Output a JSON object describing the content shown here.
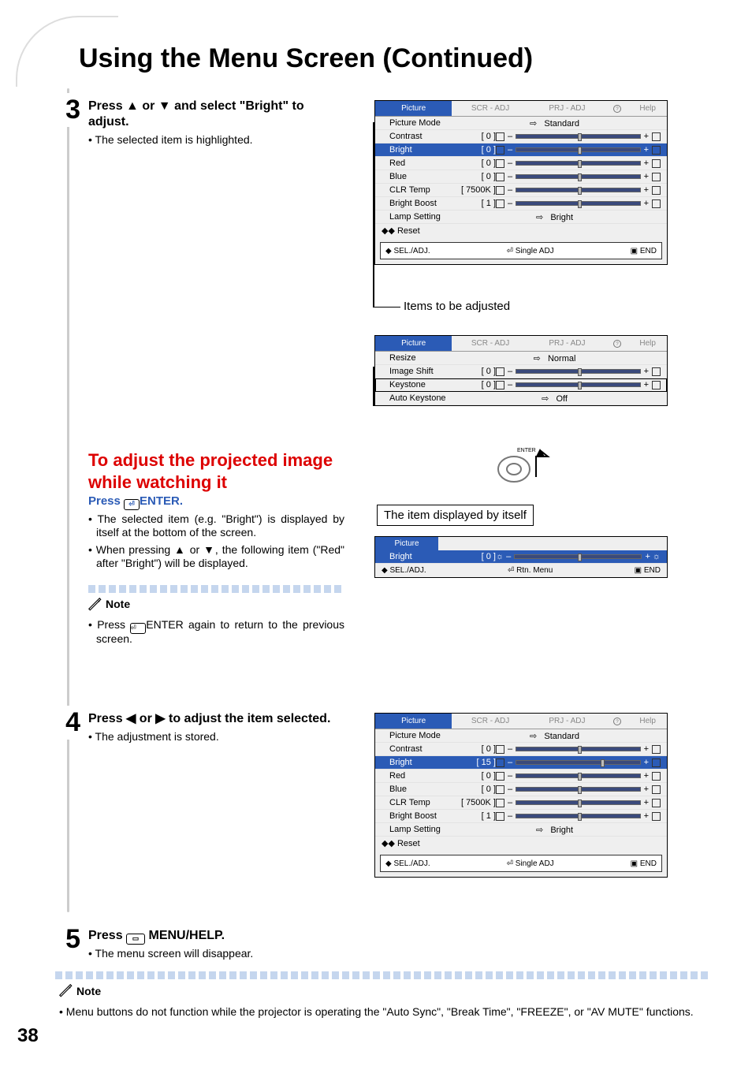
{
  "page_title": "Using the Menu Screen (Continued)",
  "page_number": "38",
  "step3": {
    "num": "3",
    "heading_pre": "Press ",
    "heading_mid": " or ",
    "heading_post": " and select \"Bright\" to adjust.",
    "bullet": "• The selected item is highlighted."
  },
  "adjust_section": {
    "red1": "To adjust the projected image while watching it",
    "press": "Press ",
    "enter_label": "ENTER.",
    "b1": "• The selected item (e.g. \"Bright\") is displayed by itself at the bottom of the screen.",
    "b2_pre": "• When pressing ",
    "b2_mid": " or ",
    "b2_post": ", the following item (\"Red\" after \"Bright\") will be displayed.",
    "note_label": "Note",
    "note_body_pre": "• Press ",
    "note_body_post": "ENTER again to return to the previous screen."
  },
  "step4": {
    "num": "4",
    "heading_pre": "Press ",
    "heading_mid": " or ",
    "heading_post": " to adjust the item selected.",
    "bullet": "• The adjustment is stored."
  },
  "step5": {
    "num": "5",
    "heading_pre": "Press ",
    "heading_post": " MENU/HELP.",
    "bullet": "• The menu screen will disappear."
  },
  "footnote": {
    "label": "Note",
    "text": "• Menu buttons do not function while the projector is operating the \"Auto Sync\", \"Break Time\", \"FREEZE\", or \"AV MUTE\" functions."
  },
  "captions": {
    "items_adjusted": "Items to be adjusted",
    "item_by_itself": "The item displayed by itself",
    "enter_label": "ENTER"
  },
  "osd_tabs": [
    "Picture",
    "SCR - ADJ",
    "PRJ - ADJ",
    "?",
    "Help"
  ],
  "osd1": {
    "rows": [
      {
        "label": "Picture Mode",
        "type": "arrow",
        "value": "Standard"
      },
      {
        "label": "Contrast",
        "type": "bar",
        "val": "0",
        "pos": 50
      },
      {
        "label": "Bright",
        "type": "bar",
        "val": "0",
        "pos": 50,
        "sel": true
      },
      {
        "label": "Red",
        "type": "bar",
        "val": "0",
        "pos": 50
      },
      {
        "label": "Blue",
        "type": "bar",
        "val": "0",
        "pos": 50
      },
      {
        "label": "CLR Temp",
        "type": "bar",
        "val": "7500K",
        "pos": 50
      },
      {
        "label": "Bright Boost",
        "type": "bar",
        "val": "1",
        "pos": 50
      },
      {
        "label": "Lamp Setting",
        "type": "arrow",
        "value": "Bright"
      },
      {
        "label": "Reset",
        "type": "reset"
      }
    ],
    "foot": {
      "l": "SEL./ADJ.",
      "m": "Single ADJ",
      "r": "END"
    }
  },
  "osd2": {
    "rows": [
      {
        "label": "Resize",
        "type": "arrow",
        "value": "Normal"
      },
      {
        "label": "Image Shift",
        "type": "bar",
        "val": "0",
        "pos": 50
      },
      {
        "label": "Keystone",
        "type": "bar",
        "val": "0",
        "pos": 50,
        "outline": true
      },
      {
        "label": "Auto Keystone",
        "type": "arrow",
        "value": "Off"
      }
    ]
  },
  "osd3": {
    "tab": "Picture",
    "row": {
      "label": "Bright",
      "val": "0",
      "pos": 50
    },
    "foot": {
      "l": "SEL./ADJ.",
      "m": "Rtn. Menu",
      "r": "END"
    }
  },
  "osd4": {
    "rows": [
      {
        "label": "Picture Mode",
        "type": "arrow",
        "value": "Standard"
      },
      {
        "label": "Contrast",
        "type": "bar",
        "val": "0",
        "pos": 50
      },
      {
        "label": "Bright",
        "type": "bar",
        "val": "15",
        "pos": 68,
        "sel": true
      },
      {
        "label": "Red",
        "type": "bar",
        "val": "0",
        "pos": 50
      },
      {
        "label": "Blue",
        "type": "bar",
        "val": "0",
        "pos": 50
      },
      {
        "label": "CLR Temp",
        "type": "bar",
        "val": "7500K",
        "pos": 50
      },
      {
        "label": "Bright Boost",
        "type": "bar",
        "val": "1",
        "pos": 50
      },
      {
        "label": "Lamp Setting",
        "type": "arrow",
        "value": "Bright"
      },
      {
        "label": "Reset",
        "type": "reset"
      }
    ],
    "foot": {
      "l": "SEL./ADJ.",
      "m": "Single ADJ",
      "r": "END"
    }
  }
}
